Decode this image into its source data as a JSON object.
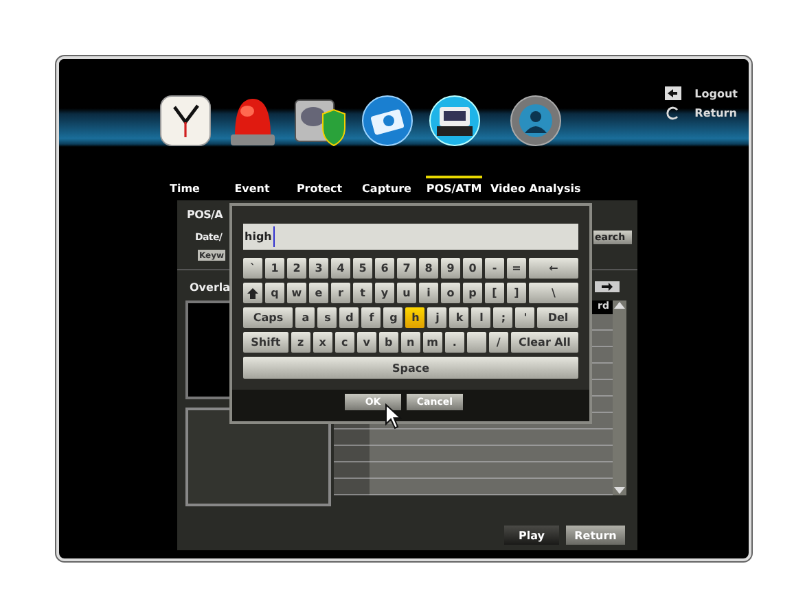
{
  "nav": {
    "items": [
      {
        "label": "Time",
        "kind": "clock",
        "selected": false
      },
      {
        "label": "Event",
        "kind": "siren",
        "selected": false
      },
      {
        "label": "Protect",
        "kind": "shield",
        "selected": false
      },
      {
        "label": "Capture",
        "kind": "camera",
        "selected": false
      },
      {
        "label": "POS/ATM",
        "kind": "register",
        "selected": true
      },
      {
        "label": "Video Analysis",
        "kind": "person",
        "selected": false
      }
    ],
    "links": [
      {
        "label": "Logout",
        "kind": "logout"
      },
      {
        "label": "Return",
        "kind": "return"
      }
    ]
  },
  "panel": {
    "title": "POS/A",
    "date_label": "Date/",
    "keyword_button": "Keyw",
    "search_button": "earch",
    "overlay_label": "Overla",
    "table": {
      "column_header": "rd"
    },
    "buttons": [
      {
        "label": "Play",
        "kind": "dark"
      },
      {
        "label": "Return",
        "kind": "light"
      }
    ]
  },
  "keyboard_dialog": {
    "input": {
      "value": "high"
    },
    "rows": [
      {
        "keys": [
          {
            "kind": "char",
            "label": "`",
            "selected": false
          },
          {
            "kind": "char",
            "label": "1",
            "selected": false
          },
          {
            "kind": "char",
            "label": "2",
            "selected": false
          },
          {
            "kind": "char",
            "label": "3",
            "selected": false
          },
          {
            "kind": "char",
            "label": "4",
            "selected": false
          },
          {
            "kind": "char",
            "label": "5",
            "selected": false
          },
          {
            "kind": "char",
            "label": "6",
            "selected": false
          },
          {
            "kind": "char",
            "label": "7",
            "selected": false
          },
          {
            "kind": "char",
            "label": "8",
            "selected": false
          },
          {
            "kind": "char",
            "label": "9",
            "selected": false
          },
          {
            "kind": "char",
            "label": "0",
            "selected": false
          },
          {
            "kind": "char",
            "label": "-",
            "selected": false
          },
          {
            "kind": "char",
            "label": "=",
            "selected": false
          },
          {
            "kind": "wide",
            "label": "←",
            "selected": false
          }
        ]
      },
      {
        "keys": [
          {
            "kind": "shift-icon",
            "selected": false
          },
          {
            "kind": "char",
            "label": "q",
            "selected": false
          },
          {
            "kind": "char",
            "label": "w",
            "selected": false
          },
          {
            "kind": "char",
            "label": "e",
            "selected": false
          },
          {
            "kind": "char",
            "label": "r",
            "selected": false
          },
          {
            "kind": "char",
            "label": "t",
            "selected": false
          },
          {
            "kind": "char",
            "label": "y",
            "selected": false
          },
          {
            "kind": "char",
            "label": "u",
            "selected": false
          },
          {
            "kind": "char",
            "label": "i",
            "selected": false
          },
          {
            "kind": "char",
            "label": "o",
            "selected": false
          },
          {
            "kind": "char",
            "label": "p",
            "selected": false
          },
          {
            "kind": "char",
            "label": "[",
            "selected": false
          },
          {
            "kind": "char",
            "label": "]",
            "selected": false
          },
          {
            "kind": "wide",
            "label": "\\",
            "selected": false
          }
        ]
      },
      {
        "keys": [
          {
            "kind": "wide",
            "label": "Caps",
            "selected": false
          },
          {
            "kind": "char",
            "label": "a",
            "selected": false
          },
          {
            "kind": "char",
            "label": "s",
            "selected": false
          },
          {
            "kind": "char",
            "label": "d",
            "selected": false
          },
          {
            "kind": "char",
            "label": "f",
            "selected": false
          },
          {
            "kind": "char",
            "label": "g",
            "selected": false
          },
          {
            "kind": "char",
            "label": "h",
            "selected": true
          },
          {
            "kind": "char",
            "label": "j",
            "selected": false
          },
          {
            "kind": "char",
            "label": "k",
            "selected": false
          },
          {
            "kind": "char",
            "label": "l",
            "selected": false
          },
          {
            "kind": "char",
            "label": ";",
            "selected": false
          },
          {
            "kind": "char",
            "label": "'",
            "selected": false
          },
          {
            "kind": "wide",
            "label": "Del",
            "selected": false
          }
        ]
      },
      {
        "keys": [
          {
            "kind": "wide",
            "label": "Shift",
            "selected": false
          },
          {
            "kind": "char",
            "label": "z",
            "selected": false
          },
          {
            "kind": "char",
            "label": "x",
            "selected": false
          },
          {
            "kind": "char",
            "label": "c",
            "selected": false
          },
          {
            "kind": "char",
            "label": "v",
            "selected": false
          },
          {
            "kind": "char",
            "label": "b",
            "selected": false
          },
          {
            "kind": "char",
            "label": "n",
            "selected": false
          },
          {
            "kind": "char",
            "label": "m",
            "selected": false
          },
          {
            "kind": "char",
            "label": ".",
            "selected": false
          },
          {
            "kind": "blank",
            "selected": false
          },
          {
            "kind": "char",
            "label": "/",
            "selected": false
          },
          {
            "kind": "wide",
            "label": "Clear All",
            "selected": false
          }
        ]
      },
      {
        "keys": [
          {
            "kind": "space",
            "label": "Space",
            "selected": false
          }
        ]
      }
    ],
    "buttons": [
      {
        "label": "OK"
      },
      {
        "label": "Cancel"
      }
    ]
  }
}
